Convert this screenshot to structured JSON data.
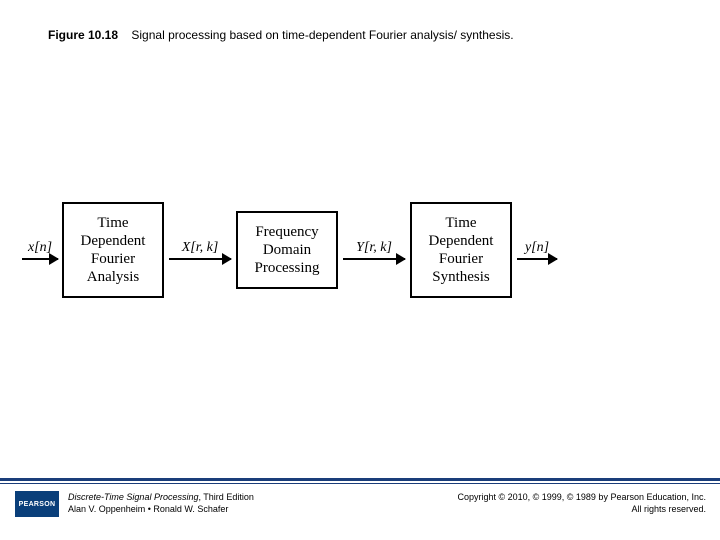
{
  "caption": {
    "label": "Figure 10.18",
    "text": "Signal processing based on time-dependent Fourier analysis/ synthesis."
  },
  "diagram": {
    "signals": {
      "in": "x[n]",
      "s1": "X[r, k]",
      "s2": "Y[r, k]",
      "out": "y[n]"
    },
    "boxes": {
      "b1": "Time\nDependent\nFourier\nAnalysis",
      "b2": "Frequency\nDomain\nProcessing",
      "b3": "Time\nDependent\nFourier\nSynthesis"
    }
  },
  "footer": {
    "logo": "PEARSON",
    "book_title": "Discrete-Time Signal Processing",
    "edition": ", Third Edition",
    "authors": "Alan V. Oppenheim • Ronald W. Schafer",
    "copyright_line1": "Copyright © 2010, © 1999, © 1989 by Pearson Education, Inc.",
    "copyright_line2": "All rights reserved."
  }
}
